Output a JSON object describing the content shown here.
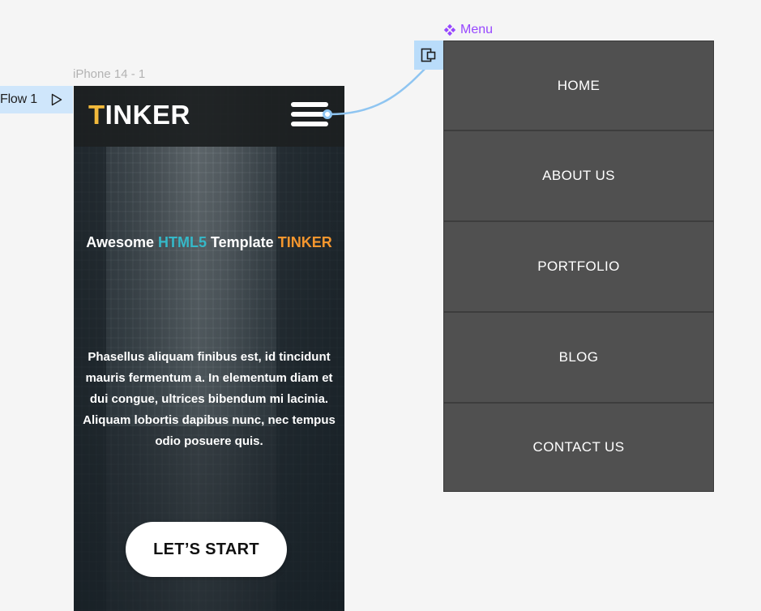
{
  "canvas": {
    "flow_label": "Flow 1",
    "frame_label": "iPhone 14 - 1",
    "component_label": "Menu"
  },
  "site": {
    "logo_first": "T",
    "logo_rest": "INKER",
    "headline": {
      "part1": "Awesome ",
      "part2": "HTML5",
      "part3": " Template ",
      "part4": "TINKER"
    },
    "body": "Phasellus aliquam finibus est, id tincidunt mauris fermentum a. In elementum diam et dui congue, ultrices bibendum mi lacinia. Aliquam lobortis dapibus nunc, nec tempus odio posuere quis.",
    "cta_label": "LET’S START"
  },
  "menu": {
    "items": [
      {
        "label": "HOME"
      },
      {
        "label": "ABOUT US"
      },
      {
        "label": "PORTFOLIO"
      },
      {
        "label": "BLOG"
      },
      {
        "label": "CONTACT US"
      }
    ]
  },
  "colors": {
    "logo_accent": "#f2b93b",
    "html5_accent": "#35b8c8",
    "tinker_accent": "#f4962e",
    "component_purple": "#9747ff",
    "prototype_blue": "#8fc5f1",
    "menu_bg": "#505050"
  },
  "icons": {
    "flow_start": "play-outline-icon",
    "hamburger": "hamburger-menu-icon",
    "component": "component-diamond-icon",
    "destination": "frame-destination-icon"
  }
}
